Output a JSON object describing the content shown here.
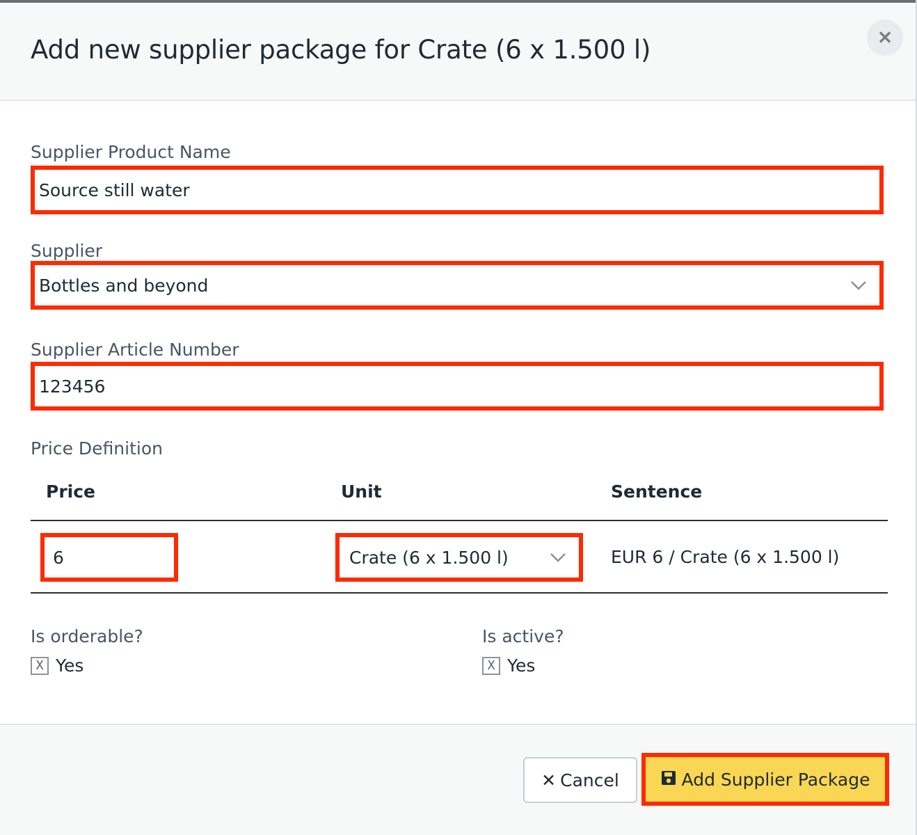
{
  "modal": {
    "title": "Add new supplier package for Crate (6 x 1.500 l)",
    "close_icon": "close-icon"
  },
  "form": {
    "product_name": {
      "label": "Supplier Product Name",
      "value": "Source still water"
    },
    "supplier": {
      "label": "Supplier",
      "selected": "Bottles and beyond"
    },
    "article_number": {
      "label": "Supplier Article Number",
      "value": "123456"
    },
    "price_definition": {
      "label": "Price Definition",
      "columns": [
        "Price",
        "Unit",
        "Sentence"
      ],
      "row": {
        "price": "6",
        "unit": "Crate (6 x 1.500 l)",
        "sentence": "EUR 6 / Crate (6 x 1.500 l)"
      }
    },
    "orderable": {
      "label": "Is orderable?",
      "option": "Yes",
      "mark": "X"
    },
    "active": {
      "label": "Is active?",
      "option": "Yes",
      "mark": "X"
    }
  },
  "footer": {
    "cancel_label": "Cancel",
    "add_label": "Add Supplier Package"
  },
  "colors": {
    "highlight": "#ff2a00",
    "primary_button": "#f9d653",
    "header_bg": "#f7f8f8"
  }
}
